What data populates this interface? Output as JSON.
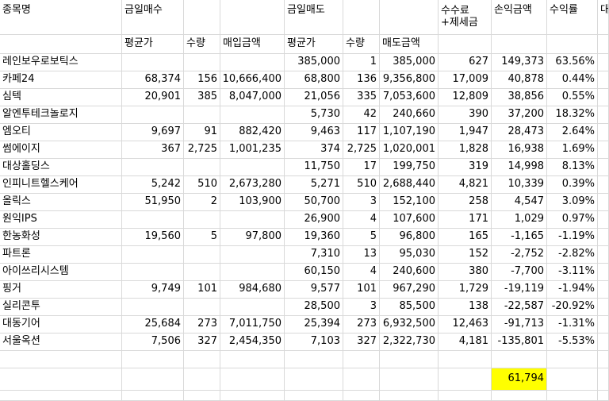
{
  "headers": {
    "name": "종목명",
    "buy": "금일매수",
    "sell": "금일매도",
    "fee_line1": "수수료",
    "fee_line2": "+제세금",
    "profit": "손익금액",
    "rate": "수익률",
    "extra": "대"
  },
  "subheaders": {
    "buy_avg": "평균가",
    "buy_qty": "수량",
    "buy_amt": "매입금액",
    "sell_avg": "평균가",
    "sell_qty": "수량",
    "sell_amt": "매도금액"
  },
  "rows": [
    [
      "레인보우로보틱스",
      "",
      "",
      "",
      "385,000",
      "1",
      "385,000",
      "627",
      "149,373",
      "63.56%"
    ],
    [
      "카페24",
      "68,374",
      "156",
      "10,666,400",
      "68,800",
      "136",
      "9,356,800",
      "17,009",
      "40,878",
      "0.44%"
    ],
    [
      "심텍",
      "20,901",
      "385",
      "8,047,000",
      "21,056",
      "335",
      "7,053,600",
      "12,809",
      "38,856",
      "0.55%"
    ],
    [
      "알엔투테크놀로지",
      "",
      "",
      "",
      "5,730",
      "42",
      "240,660",
      "390",
      "37,200",
      "18.32%"
    ],
    [
      "엠오티",
      "9,697",
      "91",
      "882,420",
      "9,463",
      "117",
      "1,107,190",
      "1,947",
      "28,473",
      "2.64%"
    ],
    [
      "썸에이지",
      "367",
      "2,725",
      "1,001,235",
      "374",
      "2,725",
      "1,020,001",
      "1,828",
      "16,938",
      "1.69%"
    ],
    [
      "대상홀딩스",
      "",
      "",
      "",
      "11,750",
      "17",
      "199,750",
      "319",
      "14,998",
      "8.13%"
    ],
    [
      "인피니트헬스케어",
      "5,242",
      "510",
      "2,673,280",
      "5,271",
      "510",
      "2,688,440",
      "4,821",
      "10,339",
      "0.39%"
    ],
    [
      "올릭스",
      "51,950",
      "2",
      "103,900",
      "50,700",
      "3",
      "152,100",
      "258",
      "4,547",
      "3.09%"
    ],
    [
      "원익IPS",
      "",
      "",
      "",
      "26,900",
      "4",
      "107,600",
      "171",
      "1,029",
      "0.97%"
    ],
    [
      "한농화성",
      "19,560",
      "5",
      "97,800",
      "19,360",
      "5",
      "96,800",
      "165",
      "-1,165",
      "-1.19%"
    ],
    [
      "파트론",
      "",
      "",
      "",
      "7,310",
      "13",
      "95,030",
      "152",
      "-2,752",
      "-2.82%"
    ],
    [
      "아이쓰리시스템",
      "",
      "",
      "",
      "60,150",
      "4",
      "240,600",
      "380",
      "-7,700",
      "-3.11%"
    ],
    [
      "핑거",
      "9,749",
      "101",
      "984,680",
      "9,577",
      "101",
      "967,290",
      "1,729",
      "-19,119",
      "-1.94%"
    ],
    [
      "실리콘투",
      "",
      "",
      "",
      "28,500",
      "3",
      "85,500",
      "138",
      "-22,587",
      "-20.92%"
    ],
    [
      "대동기어",
      "25,684",
      "273",
      "7,011,750",
      "25,394",
      "273",
      "6,932,500",
      "12,463",
      "-91,713",
      "-1.31%"
    ],
    [
      "서울옥션",
      "7,506",
      "327",
      "2,454,350",
      "7,103",
      "327",
      "2,322,730",
      "4,181",
      "-135,801",
      "-5.53%"
    ]
  ],
  "total": "61,794",
  "colors": {
    "highlight": "#ffff00",
    "gridline": "#d9d9d9"
  }
}
